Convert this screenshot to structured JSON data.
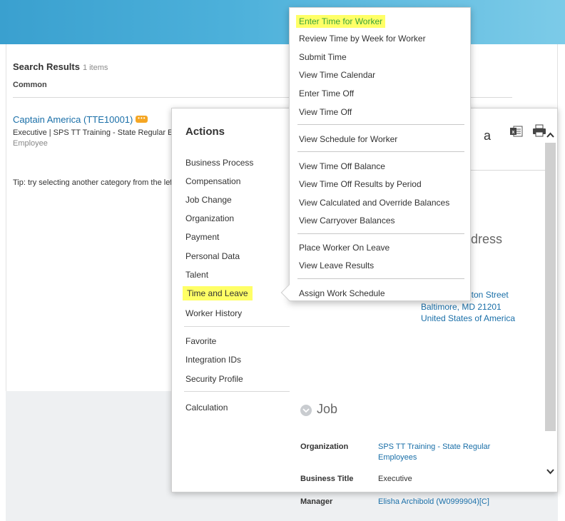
{
  "search": {
    "title": "Search Results",
    "count": "1 items",
    "category": "Common"
  },
  "result": {
    "name": "Captain America (TTE10001)",
    "subtitle": "Executive | SPS TT Training - State Regular Employees",
    "type": "Employee"
  },
  "tip": "Tip: try selecting another category from the left",
  "actions": {
    "title": "Actions",
    "items": [
      "Business Process",
      "Compensation",
      "Job Change",
      "Organization",
      "Payment",
      "Personal Data",
      "Talent",
      "Time and Leave",
      "Worker History",
      "Favorite",
      "Integration IDs",
      "Security Profile",
      "Calculation"
    ],
    "highlighted": "Time and Leave"
  },
  "submenu": {
    "items": [
      "Enter Time for Worker",
      "Review Time by Week for Worker",
      "Submit Time",
      "View Time Calendar",
      "Enter Time Off",
      "View Time Off",
      "View Schedule for Worker",
      "View Time Off Balance",
      "View Time Off Results by Period",
      "View Calculated and Override Balances",
      "View Carryover Balances",
      "Place Worker On Leave",
      "View Leave Results",
      "Assign Work Schedule"
    ],
    "highlighted": "Enter Time for Worker"
  },
  "profile": {
    "name_tail": "a",
    "address_heading": "dress",
    "address": [
      "eston Street",
      "Baltimore, MD 21201",
      "United States of America"
    ],
    "job": {
      "title": "Job",
      "fields": [
        {
          "label": "Organization",
          "value": "SPS TT Training - State Regular Employees"
        },
        {
          "label": "Business Title",
          "value": "Executive"
        },
        {
          "label": "Manager",
          "value": "Elisha Archibold (W0999904)[C]"
        }
      ]
    }
  },
  "colors": {
    "banner": "#4cb0da",
    "highlight": "#ffff66",
    "link": "#1a6fa8",
    "badge": "#f5a623",
    "highlight_text": "#3aa33a"
  },
  "icons": [
    "excel-icon",
    "print-icon",
    "chevron-up-icon",
    "chevron-down-icon",
    "more-actions-icon",
    "expand-circle-icon"
  ]
}
